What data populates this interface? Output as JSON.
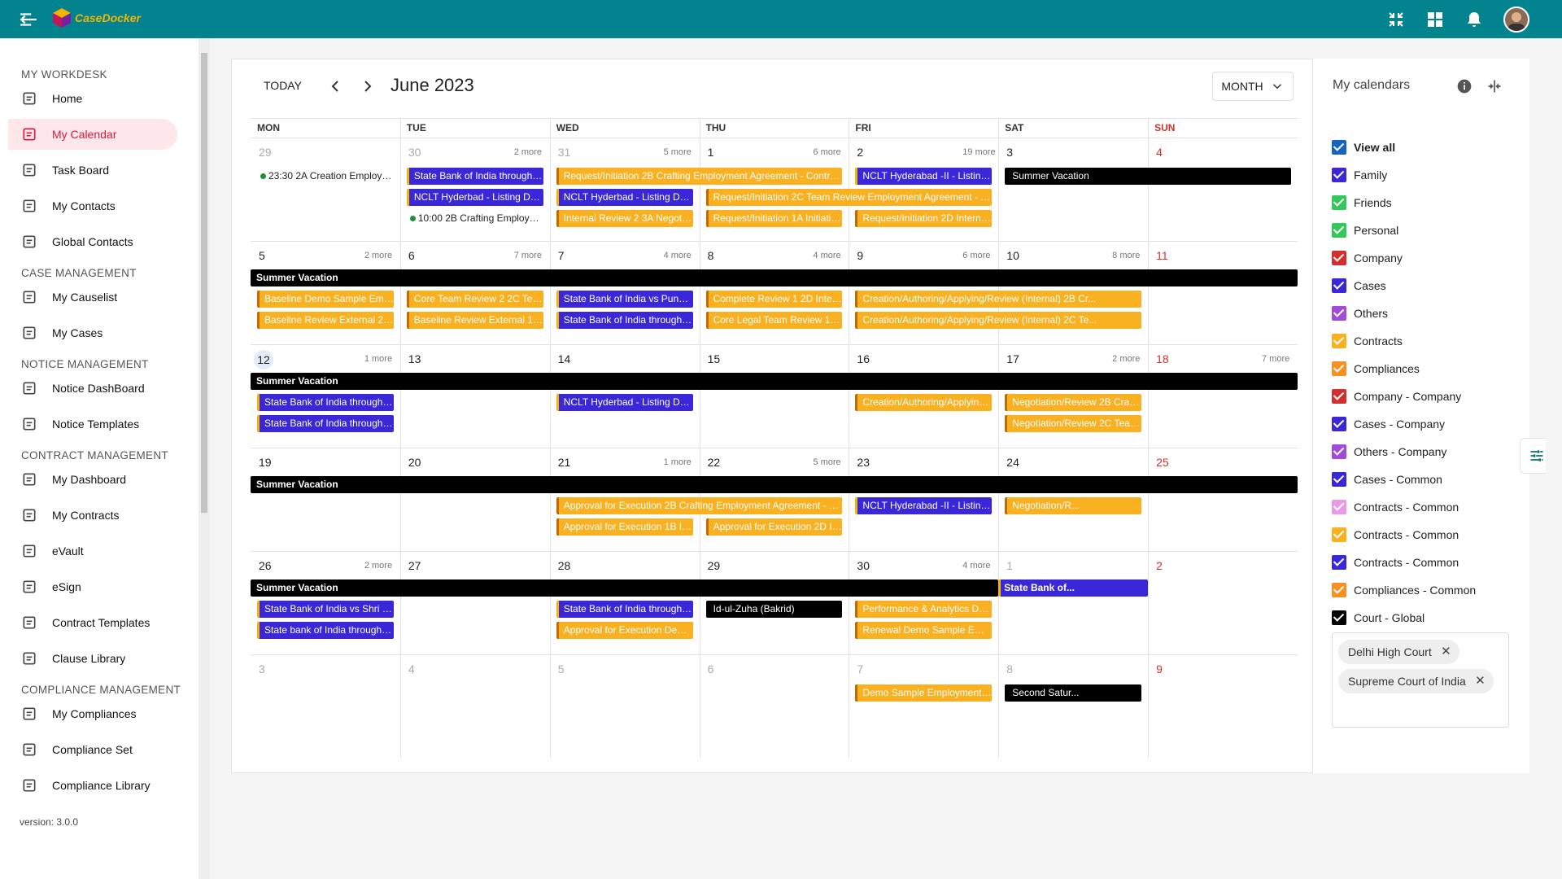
{
  "app": {
    "logo_text": "CaseDocker",
    "version": "version: 3.0.0"
  },
  "sidebar": {
    "sections": [
      {
        "title": "MY WORKDESK",
        "items": [
          "Home",
          "My Calendar",
          "Task Board",
          "My Contacts",
          "Global Contacts"
        ]
      },
      {
        "title": "CASE MANAGEMENT",
        "items": [
          "My Causelist",
          "My Cases"
        ]
      },
      {
        "title": "NOTICE MANAGEMENT",
        "items": [
          "Notice DashBoard",
          "Notice Templates"
        ]
      },
      {
        "title": "CONTRACT MANAGEMENT",
        "items": [
          "My Dashboard",
          "My Contracts",
          "eVault",
          "eSign",
          "Contract Templates",
          "Clause Library"
        ]
      },
      {
        "title": "COMPLIANCE MANAGEMENT",
        "items": [
          "My Compliances",
          "Compliance Set",
          "Compliance Library"
        ]
      }
    ],
    "active_item": "My Calendar"
  },
  "calendar": {
    "today_label": "TODAY",
    "month_title": "June 2023",
    "view_label": "MONTH",
    "weekdays": [
      "MON",
      "TUE",
      "WED",
      "THU",
      "FRI",
      "SAT",
      "SUN"
    ],
    "weeks": [
      {
        "days": [
          "29",
          "30",
          "31",
          "1",
          "2",
          "3",
          "4"
        ],
        "more": [
          "",
          "2 more",
          "5 more",
          "6 more",
          "19 more",
          "",
          ""
        ]
      },
      {
        "days": [
          "5",
          "6",
          "7",
          "8",
          "9",
          "10",
          "11"
        ],
        "more": [
          "2 more",
          "7 more",
          "4 more",
          "4 more",
          "6 more",
          "8 more",
          ""
        ]
      },
      {
        "days": [
          "12",
          "13",
          "14",
          "15",
          "16",
          "17",
          "18"
        ],
        "more": [
          "1 more",
          "",
          "",
          "",
          "",
          "2 more",
          "7 more"
        ]
      },
      {
        "days": [
          "19",
          "20",
          "21",
          "22",
          "23",
          "24",
          "25"
        ],
        "more": [
          "",
          "",
          "1 more",
          "5 more",
          "",
          "",
          ""
        ]
      },
      {
        "days": [
          "26",
          "27",
          "28",
          "29",
          "30",
          "1",
          "2"
        ],
        "more": [
          "2 more",
          "",
          "",
          "",
          "4 more",
          "",
          ""
        ]
      },
      {
        "days": [
          "3",
          "4",
          "5",
          "6",
          "7",
          "8",
          "9"
        ],
        "more": [
          "",
          "",
          "",
          "",
          "",
          "",
          ""
        ]
      }
    ],
    "events": [
      {
        "w": 0,
        "col": 0,
        "span": 1,
        "row": 0,
        "type": "dot",
        "text": "23:30 2A Creation Employment..."
      },
      {
        "w": 0,
        "col": 1,
        "span": 1,
        "row": 0,
        "type": "blue",
        "text": "State Bank of India through its C..."
      },
      {
        "w": 0,
        "col": 1,
        "span": 1,
        "row": 1,
        "type": "blue",
        "text": "NCLT Hyderbad - Listing Date"
      },
      {
        "w": 0,
        "col": 1,
        "span": 1,
        "row": 2,
        "type": "dot",
        "text": "10:00 2B Crafting Employment ..."
      },
      {
        "w": 0,
        "col": 2,
        "span": 2,
        "row": 0,
        "type": "orange",
        "text": "Request/Initiation 2B Crafting Employment Agreement - Contract Timeli..."
      },
      {
        "w": 0,
        "col": 2,
        "span": 1,
        "row": 1,
        "type": "blue",
        "text": "NCLT Hyderbad - Listing Date"
      },
      {
        "w": 0,
        "col": 2,
        "span": 1,
        "row": 2,
        "type": "orange",
        "text": "Internal Review 2 3A Negotiation..."
      },
      {
        "w": 0,
        "col": 3,
        "span": 2,
        "row": 1,
        "type": "orange",
        "text": "Request/Initiation 2C Team Review Employment Agreement - Contract T..."
      },
      {
        "w": 0,
        "col": 3,
        "span": 1,
        "row": 2,
        "type": "orange",
        "text": "Request/Initiation 1A Initiation E..."
      },
      {
        "w": 0,
        "col": 4,
        "span": 1,
        "row": 0,
        "type": "blue",
        "text": "NCLT Hyderabad -II - Listing Date"
      },
      {
        "w": 0,
        "col": 4,
        "span": 1,
        "row": 2,
        "type": "orange",
        "text": "Request/Initiation 2D Internal Re..."
      },
      {
        "w": 0,
        "col": 5,
        "span": 2,
        "row": 0,
        "type": "black",
        "text": "Summer Vacation"
      },
      {
        "w": 1,
        "col": 0,
        "span": 7,
        "row": -1,
        "type": "black",
        "text": "Summer Vacation"
      },
      {
        "w": 1,
        "col": 0,
        "span": 1,
        "row": 0,
        "type": "orange",
        "text": "Baseline Demo Sample Employm..."
      },
      {
        "w": 1,
        "col": 0,
        "span": 1,
        "row": 1,
        "type": "orange",
        "text": "Baseline Review External 2 Demo..."
      },
      {
        "w": 1,
        "col": 1,
        "span": 1,
        "row": 0,
        "type": "orange",
        "text": "Core Team Review 2 2C Team Re..."
      },
      {
        "w": 1,
        "col": 1,
        "span": 1,
        "row": 1,
        "type": "orange",
        "text": "Baseline Review External 1 Demo..."
      },
      {
        "w": 1,
        "col": 2,
        "span": 1,
        "row": 0,
        "type": "blue",
        "text": "State Bank of India vs Pune Peo..."
      },
      {
        "w": 1,
        "col": 2,
        "span": 1,
        "row": 1,
        "type": "blue",
        "text": "State Bank of India through Bhad..."
      },
      {
        "w": 1,
        "col": 3,
        "span": 1,
        "row": 0,
        "type": "orange",
        "text": "Complete Review 1 2D Internal R..."
      },
      {
        "w": 1,
        "col": 3,
        "span": 1,
        "row": 1,
        "type": "orange",
        "text": "Core Legal Team Review 1 Demo..."
      },
      {
        "w": 1,
        "col": 4,
        "span": 2,
        "row": 0,
        "type": "orange",
        "text": "Creation/Authoring/Applying/Review (Internal) 2B Cr..."
      },
      {
        "w": 1,
        "col": 4,
        "span": 2,
        "row": 1,
        "type": "orange",
        "text": "Creation/Authoring/Applying/Review (Internal) 2C Te..."
      },
      {
        "w": 2,
        "col": 0,
        "span": 7,
        "row": -1,
        "type": "black",
        "text": "Summer Vacation"
      },
      {
        "w": 2,
        "col": 0,
        "span": 1,
        "row": 0,
        "type": "blue",
        "text": "State Bank of India through Bran..."
      },
      {
        "w": 2,
        "col": 0,
        "span": 1,
        "row": 1,
        "type": "blue",
        "text": "State Bank of India through Alan..."
      },
      {
        "w": 2,
        "col": 2,
        "span": 1,
        "row": 0,
        "type": "blue",
        "text": "NCLT Hyderbad - Listing Date"
      },
      {
        "w": 2,
        "col": 4,
        "span": 1,
        "row": 0,
        "type": "orange",
        "text": "Creation/Authoring/Applying/Revi..."
      },
      {
        "w": 2,
        "col": 5,
        "span": 1,
        "row": 0,
        "type": "orange",
        "text": "Negotiation/Review 2B Crafting E..."
      },
      {
        "w": 2,
        "col": 5,
        "span": 1,
        "row": 1,
        "type": "orange",
        "text": "Negotiation/Review 2C Team Rev..."
      },
      {
        "w": 3,
        "col": 0,
        "span": 7,
        "row": -1,
        "type": "black",
        "text": "Summer Vacation"
      },
      {
        "w": 3,
        "col": 2,
        "span": 2,
        "row": 0,
        "type": "orange",
        "text": "Approval for Execution 2B Crafting Employment Agreement - Contract Ti..."
      },
      {
        "w": 3,
        "col": 2,
        "span": 1,
        "row": 1,
        "type": "orange",
        "text": "Approval for Execution 1B Initiati..."
      },
      {
        "w": 3,
        "col": 3,
        "span": 1,
        "row": 1,
        "type": "orange",
        "text": "Approval for Execution 2D Intern..."
      },
      {
        "w": 3,
        "col": 4,
        "span": 1,
        "row": 0,
        "type": "blue",
        "text": "NCLT Hyderabad -II - Listing Date"
      },
      {
        "w": 3,
        "col": 5,
        "span": 1,
        "row": 0,
        "type": "orange",
        "text": "Negotiation/R..."
      },
      {
        "w": 4,
        "col": 0,
        "span": 5,
        "row": -1,
        "type": "black",
        "text": "Summer Vacation"
      },
      {
        "w": 4,
        "col": 5,
        "span": 1,
        "row": -1,
        "type": "blue",
        "text": "State Bank of..."
      },
      {
        "w": 4,
        "col": 0,
        "span": 1,
        "row": 0,
        "type": "blue",
        "text": "State Bank of India vs Shri Rajan..."
      },
      {
        "w": 4,
        "col": 0,
        "span": 1,
        "row": 1,
        "type": "blue",
        "text": "State bank of India throughAnjali..."
      },
      {
        "w": 4,
        "col": 2,
        "span": 1,
        "row": 0,
        "type": "blue",
        "text": "State Bank of India through its C..."
      },
      {
        "w": 4,
        "col": 2,
        "span": 1,
        "row": 1,
        "type": "orange",
        "text": "Approval for Execution Demo Sa..."
      },
      {
        "w": 4,
        "col": 3,
        "span": 1,
        "row": 0,
        "type": "black",
        "text": "Id-ul-Zuha (Bakrid)"
      },
      {
        "w": 4,
        "col": 4,
        "span": 1,
        "row": 0,
        "type": "orange",
        "text": "Performance & Analytics Demo S..."
      },
      {
        "w": 4,
        "col": 4,
        "span": 1,
        "row": 1,
        "type": "orange",
        "text": "Renewal Demo Sample Employm..."
      },
      {
        "w": 5,
        "col": 4,
        "span": 1,
        "row": 0,
        "type": "orange",
        "text": "Demo Sample Employment Agree..."
      },
      {
        "w": 5,
        "col": 5,
        "span": 1,
        "row": 0,
        "type": "black",
        "text": "Second Satur..."
      }
    ]
  },
  "my_calendars": {
    "title": "My calendars",
    "items": [
      {
        "label": "View all",
        "color": "#1565c0",
        "bold": true
      },
      {
        "label": "Family",
        "color": "#3a27d8"
      },
      {
        "label": "Friends",
        "color": "#34c759"
      },
      {
        "label": "Personal",
        "color": "#34c759"
      },
      {
        "label": "Company",
        "color": "#d32f2f"
      },
      {
        "label": "Cases",
        "color": "#3a27d8"
      },
      {
        "label": "Others",
        "color": "#a04cd8"
      },
      {
        "label": "Contracts",
        "color": "#f9b021"
      },
      {
        "label": "Compliances",
        "color": "#f99021"
      },
      {
        "label": "Company - Company",
        "color": "#d32f2f"
      },
      {
        "label": "Cases - Company",
        "color": "#3a27d8"
      },
      {
        "label": "Others - Company",
        "color": "#a04cd8"
      },
      {
        "label": "Cases - Common",
        "color": "#3a27d8"
      },
      {
        "label": "Contracts - Common",
        "color": "#e89ae8"
      },
      {
        "label": "Contracts - Common",
        "color": "#f9b021"
      },
      {
        "label": "Contracts - Common",
        "color": "#3a27d8"
      },
      {
        "label": "Compliances - Common",
        "color": "#f99021"
      },
      {
        "label": "Court - Global",
        "color": "#000000"
      }
    ],
    "courts": [
      "Delhi High Court",
      "Supreme Court of India"
    ]
  }
}
